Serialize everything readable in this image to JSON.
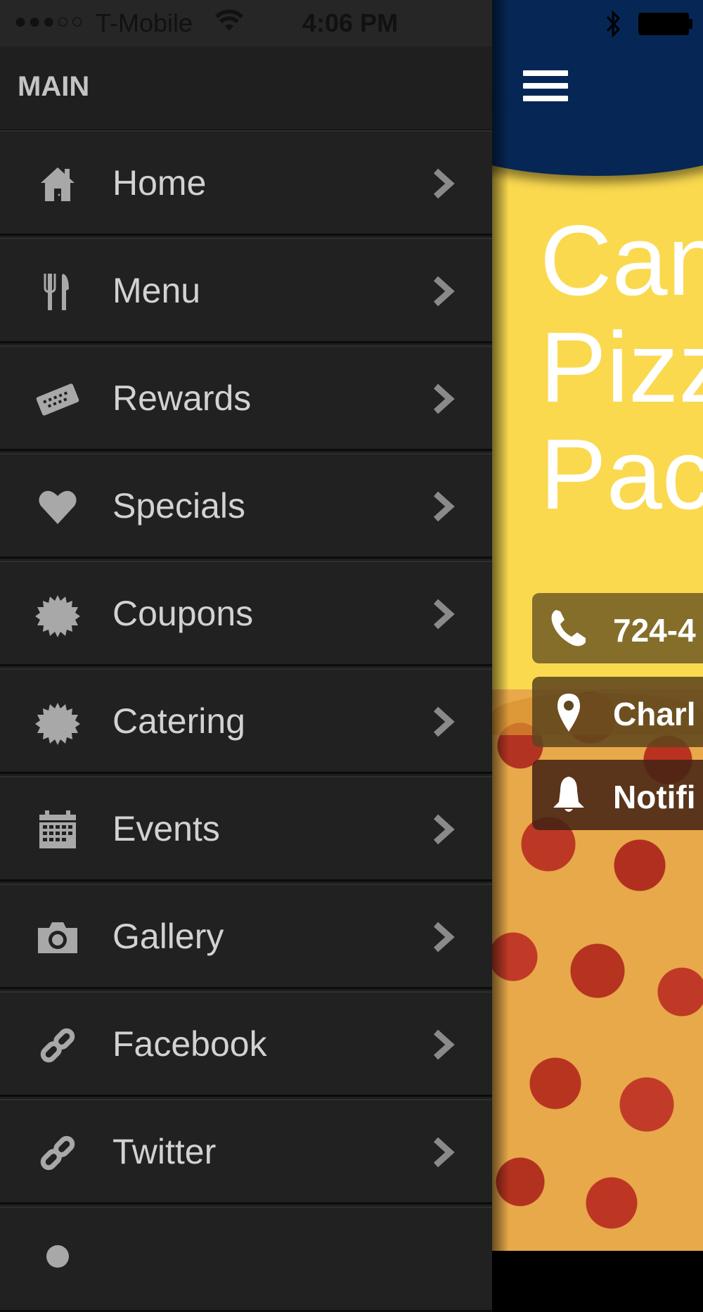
{
  "status_bar": {
    "signal": "●●●○○",
    "carrier": "T-Mobile",
    "time": "4:06 PM"
  },
  "drawer": {
    "section_title": "MAIN",
    "items": [
      {
        "label": "Home",
        "icon": "home-icon"
      },
      {
        "label": "Menu",
        "icon": "fork-knife-icon"
      },
      {
        "label": "Rewards",
        "icon": "ticket-icon"
      },
      {
        "label": "Specials",
        "icon": "heart-icon"
      },
      {
        "label": "Coupons",
        "icon": "badge-icon"
      },
      {
        "label": "Catering",
        "icon": "badge-icon"
      },
      {
        "label": "Events",
        "icon": "calendar-icon"
      },
      {
        "label": "Gallery",
        "icon": "camera-icon"
      },
      {
        "label": "Facebook",
        "icon": "link-icon"
      },
      {
        "label": "Twitter",
        "icon": "link-icon"
      }
    ]
  },
  "app": {
    "title_lines": [
      "Can",
      "Pizz",
      "Pac"
    ],
    "buttons": {
      "phone": "724-4",
      "location": "Charl",
      "notifications": "Notifi"
    }
  },
  "colors": {
    "drawer_bg": "#212121",
    "header_bg": "#062755",
    "content_bg": "#fad94f"
  }
}
